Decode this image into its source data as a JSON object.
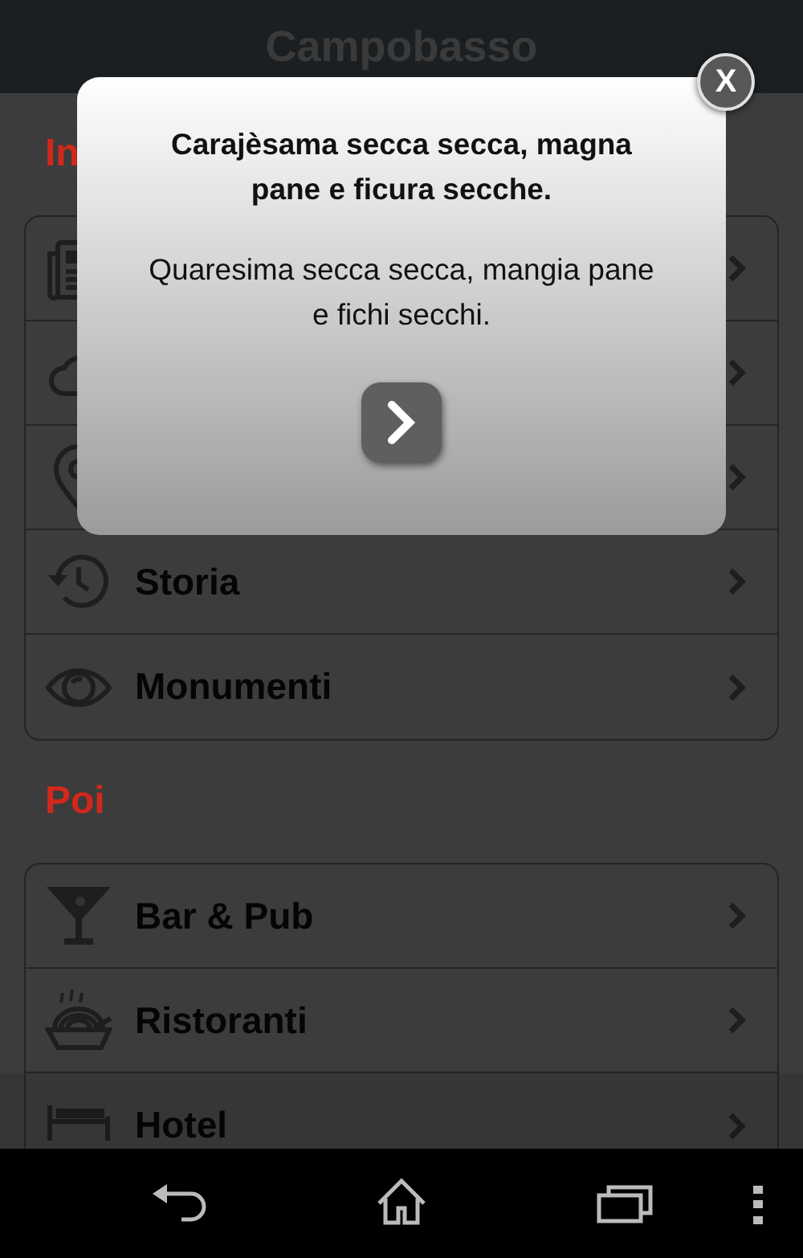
{
  "header": {
    "title": "Campobasso"
  },
  "sections": [
    {
      "title": "In",
      "items": [
        {
          "kind": "covered"
        },
        {
          "kind": "covered"
        },
        {
          "kind": "covered"
        },
        {
          "kind": "labeled",
          "label": "Storia"
        },
        {
          "kind": "labeled",
          "label": "Monumenti"
        }
      ]
    },
    {
      "title": "Poi",
      "items": [
        {
          "kind": "labeled",
          "label": "Bar & Pub"
        },
        {
          "kind": "labeled",
          "label": "Ristoranti"
        },
        {
          "kind": "labeled",
          "label": "Hotel"
        }
      ]
    }
  ],
  "popup": {
    "title": "Carajèsama secca secca, magna pane e ficura secche.",
    "text": "Quaresima secca secca, mangia pane e fichi secchi.",
    "close": "X"
  }
}
